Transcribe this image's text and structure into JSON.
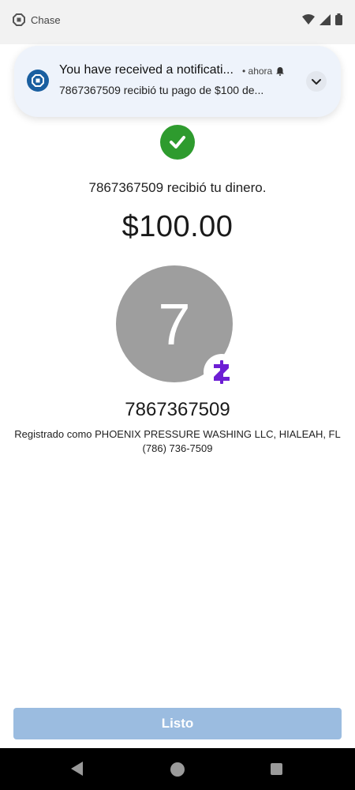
{
  "status_bar": {
    "app_name": "Chase",
    "icons": [
      "chase-logo-icon",
      "wifi-icon",
      "signal-icon",
      "battery-icon"
    ]
  },
  "notification": {
    "title": "You have received a notificati...",
    "time": "• ahora",
    "body": "7867367509 recibió tu pago de $100 de...",
    "icons": [
      "chase-logo-icon",
      "alert-bell-icon",
      "chevron-down-icon"
    ],
    "icon_color": "#1a5fa0"
  },
  "confirmation": {
    "message": "7867367509 recibió tu dinero.",
    "amount": "$100.00",
    "success_color": "#2e9b2e"
  },
  "recipient": {
    "avatar_initial": "7",
    "name": "7867367509",
    "registered_line1": "Registrado como PHOENIX PRESSURE WASHING LLC, HIALEAH, FL",
    "registered_line2": "(786) 736-7509",
    "badge_icon": "zelle-icon",
    "badge_color": "#6d1ed4"
  },
  "actions": {
    "done_label": "Listo",
    "button_color": "#9bbce0"
  },
  "nav_bar": {
    "icons": [
      "back-icon",
      "home-icon",
      "recent-apps-icon"
    ]
  }
}
